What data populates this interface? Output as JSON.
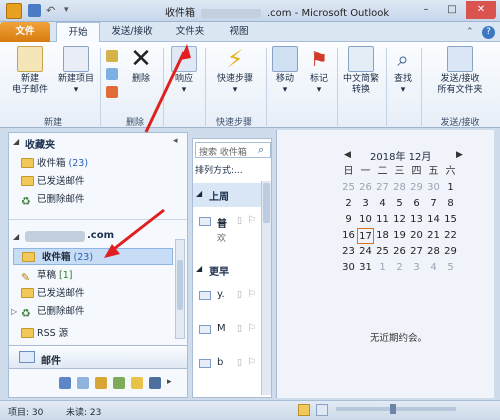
{
  "titlebar": {
    "title_prefix": "收件箱",
    "title_suffix": ".com - Microsoft Outlook",
    "minimize": "–",
    "maximize": "□",
    "close": "✕"
  },
  "tabs": {
    "file": "文件",
    "home": "开始",
    "send_receive": "发送/接收",
    "folder": "文件夹",
    "view": "视图",
    "help": "?"
  },
  "ribbon": {
    "new_email": "新建\n电子邮件",
    "new_items": "新建项目",
    "delete": "删除",
    "respond": "响应",
    "quick_steps": "快速步骤",
    "move": "移动",
    "tags": "标记",
    "chinese_conv": "中文简繁\n转换",
    "find": "查找",
    "send_recv_all": "发送/接收\n所有文件夹",
    "groups": {
      "new": "新建",
      "delete": "删除",
      "quick_steps": "快速步骤",
      "send_recv": "发送/接收"
    }
  },
  "nav": {
    "favorites_header": "收藏夹",
    "favorites": [
      {
        "label": "收件箱",
        "count": "(23)"
      },
      {
        "label": "已发送邮件",
        "count": ""
      },
      {
        "label": "已删除邮件",
        "count": ""
      }
    ],
    "account_header": ".com",
    "account_items": [
      {
        "label": "收件箱",
        "count": "(23)"
      },
      {
        "label": "草稿",
        "count": "[1]"
      },
      {
        "label": "已发送邮件",
        "count": ""
      },
      {
        "label": "已删除邮件",
        "count": ""
      },
      {
        "label": "RSS 源",
        "count": ""
      }
    ],
    "mail_button": "邮件"
  },
  "list": {
    "search_placeholder": "搜索 收件箱",
    "sort_label": "排列方式:...",
    "group_last_week": "上周",
    "group_earlier": "更早",
    "item1_line1": "普",
    "item1_line2": "欢",
    "item2": "y.",
    "item3": "M",
    "item4": "b"
  },
  "calendar": {
    "title": "2018年 12月",
    "weekdays": [
      "日",
      "一",
      "二",
      "三",
      "四",
      "五",
      "六"
    ],
    "weeks": [
      [
        "25",
        "26",
        "27",
        "28",
        "29",
        "30",
        "1"
      ],
      [
        "2",
        "3",
        "4",
        "5",
        "6",
        "7",
        "8"
      ],
      [
        "9",
        "10",
        "11",
        "12",
        "13",
        "14",
        "15"
      ],
      [
        "16",
        "17",
        "18",
        "19",
        "20",
        "21",
        "22"
      ],
      [
        "23",
        "24",
        "25",
        "26",
        "27",
        "28",
        "29"
      ],
      [
        "30",
        "31",
        "1",
        "2",
        "3",
        "4",
        "5"
      ]
    ],
    "today": "17",
    "no_appointments": "无近期约会。"
  },
  "status": {
    "items": "项目: 30",
    "unread": "未读: 23"
  },
  "colors": {
    "accent": "#e8a021",
    "arrow": "#e02020"
  }
}
